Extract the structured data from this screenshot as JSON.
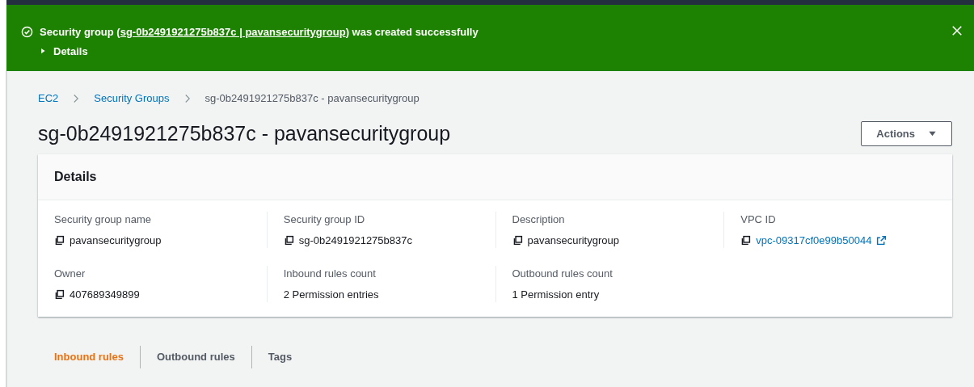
{
  "flash": {
    "prefix": "Security group (",
    "link": "sg-0b2491921275b837c | pavansecuritygroup",
    "suffix": ") was created successfully",
    "details_label": "Details",
    "expanded": false
  },
  "breadcrumbs": [
    {
      "label": "EC2",
      "link": true
    },
    {
      "label": "Security Groups",
      "link": true
    },
    {
      "label": "sg-0b2491921275b837c - pavansecuritygroup",
      "link": false
    }
  ],
  "page_title": "sg-0b2491921275b837c - pavansecuritygroup",
  "actions_button": "Actions",
  "details": {
    "title": "Details",
    "fields": [
      {
        "label": "Security group name",
        "value": "pavansecuritygroup",
        "kind": "copy"
      },
      {
        "label": "Security group ID",
        "value": "sg-0b2491921275b837c",
        "kind": "copy"
      },
      {
        "label": "Description",
        "value": "pavansecuritygroup",
        "kind": "copy"
      },
      {
        "label": "VPC ID",
        "value": "vpc-09317cf0e99b50044",
        "kind": "copy-link"
      },
      {
        "label": "Owner",
        "value": "407689349899",
        "kind": "copy"
      },
      {
        "label": "Inbound rules count",
        "value": "2 Permission entries",
        "kind": "plain"
      },
      {
        "label": "Outbound rules count",
        "value": "1 Permission entry",
        "kind": "plain"
      }
    ]
  },
  "tabs": [
    {
      "label": "Inbound rules",
      "selected": true
    },
    {
      "label": "Outbound rules",
      "selected": false
    },
    {
      "label": "Tags",
      "selected": false
    }
  ]
}
